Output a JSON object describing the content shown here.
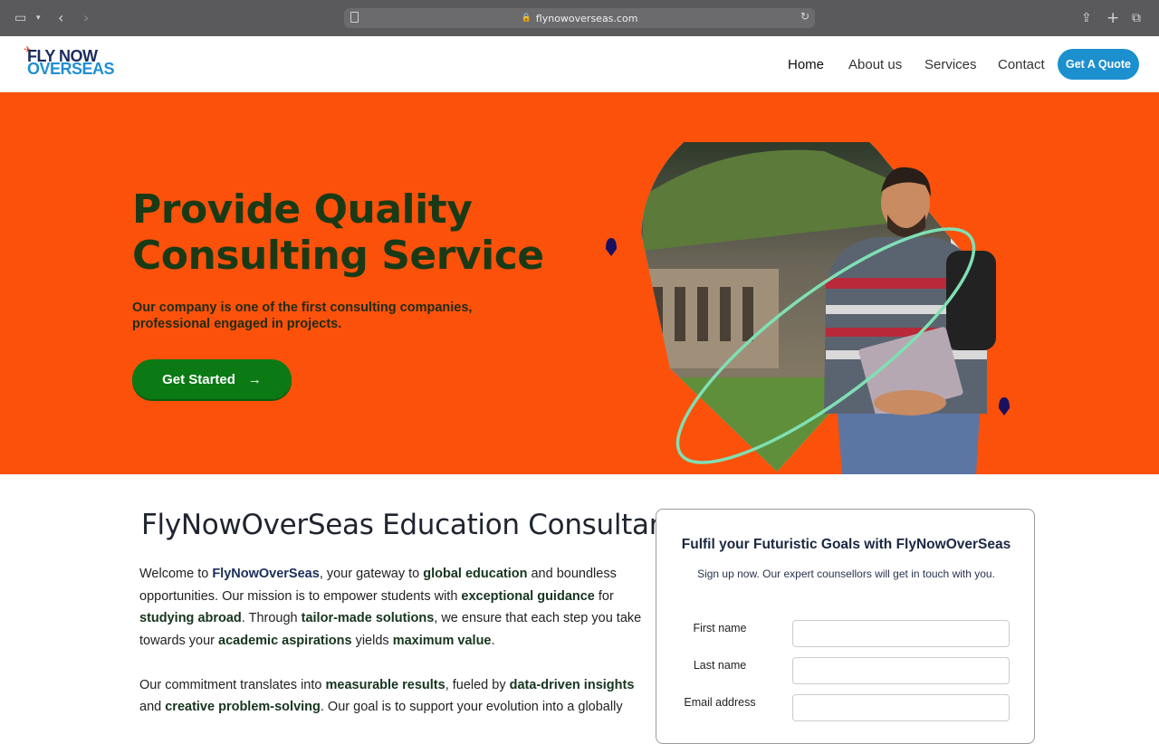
{
  "browser": {
    "url": "flynowoverseas.com"
  },
  "header": {
    "logo_line1": "FLY NOW",
    "logo_line2": "OVERSEAS",
    "nav": [
      "Home",
      "About us",
      "Services",
      "Contact"
    ],
    "quote_button": "Get A Quote"
  },
  "hero": {
    "title": "Provide Quality Consulting Service",
    "subtitle": "Our company is one of the first consulting companies, professional engaged in projects.",
    "cta": "Get Started",
    "colors": {
      "background": "#fc510b",
      "cta": "#0c7a14"
    }
  },
  "intro": {
    "title": "FlyNowOverSeas Education Consultancy",
    "p1": [
      {
        "t": "Welcome to "
      },
      {
        "b": "FlyNowOverSeas",
        "blue": true
      },
      {
        "t": ", your gateway to "
      },
      {
        "b": "global education"
      },
      {
        "t": " and boundless opportunities. Our mission is to empower students with "
      },
      {
        "b": "exceptional guidance"
      },
      {
        "t": " for "
      },
      {
        "b": "studying abroad"
      },
      {
        "t": ". Through "
      },
      {
        "b": "tailor-made solutions"
      },
      {
        "t": ", we ensure that each step you take towards your "
      },
      {
        "b": "academic aspirations"
      },
      {
        "t": " yields "
      },
      {
        "b": "maximum value"
      },
      {
        "t": "."
      }
    ],
    "p2": [
      {
        "t": "Our commitment translates into "
      },
      {
        "b": "measurable results"
      },
      {
        "t": ", fueled by "
      },
      {
        "b": "data-driven insights"
      },
      {
        "t": " and "
      },
      {
        "b": "creative problem-solving"
      },
      {
        "t": ". Our goal is to support your evolution into a globally"
      }
    ]
  },
  "form": {
    "title": "Fulfil your Futuristic Goals with FlyNowOverSeas",
    "subtitle": "Sign up now. Our expert counsellors will get in touch with you.",
    "fields": [
      {
        "label": "First name",
        "value": ""
      },
      {
        "label": "Last name",
        "value": ""
      },
      {
        "label": "Email address",
        "value": ""
      }
    ]
  }
}
